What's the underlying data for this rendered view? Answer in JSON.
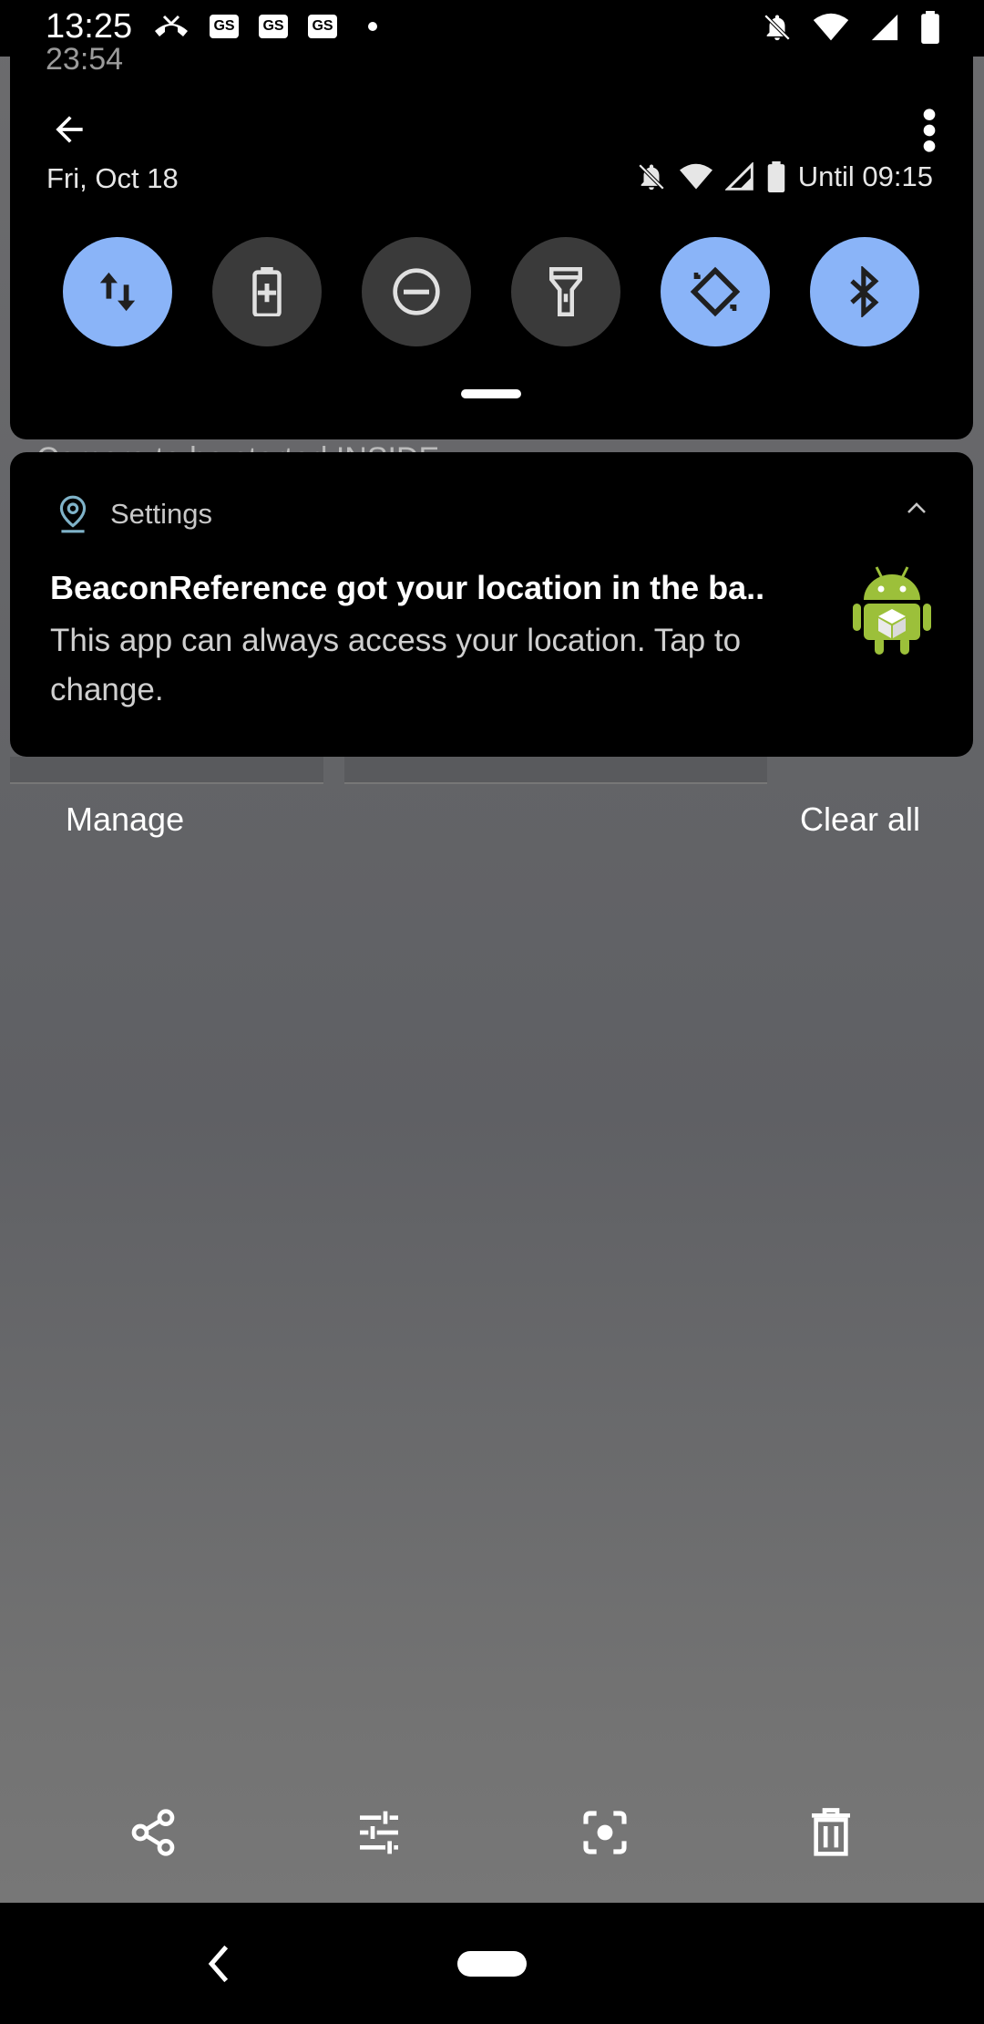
{
  "status_bar": {
    "time": "13:25",
    "left_icons": [
      "missed-call-icon",
      "gs-icon",
      "gs-icon",
      "gs-icon",
      "dot-icon"
    ],
    "gs_label": "GS",
    "right_icons": [
      "bell-off-icon",
      "wifi-icon",
      "signal-icon",
      "battery-icon"
    ]
  },
  "ghost_time": "23:54",
  "quick_settings": {
    "date": "Fri, Oct 18",
    "status_text": "Until 09:15",
    "tiles": [
      {
        "name": "mobile-data",
        "state": "on"
      },
      {
        "name": "battery-saver",
        "state": "off"
      },
      {
        "name": "do-not-disturb",
        "state": "off"
      },
      {
        "name": "flashlight",
        "state": "off"
      },
      {
        "name": "auto-rotate",
        "state": "on"
      },
      {
        "name": "bluetooth",
        "state": "on"
      }
    ],
    "accent_color": "#8ab4f8"
  },
  "behind_text": "Camera to be started INSIDE",
  "notification": {
    "app_name": "Settings",
    "title": "BeaconReference got your location in the ba..",
    "body": "This app can always access your location. Tap to change."
  },
  "actions": {
    "manage": "Manage",
    "clear_all": "Clear all"
  },
  "toolbar": [
    "share-icon",
    "adjust-icon",
    "lens-icon",
    "delete-icon"
  ]
}
